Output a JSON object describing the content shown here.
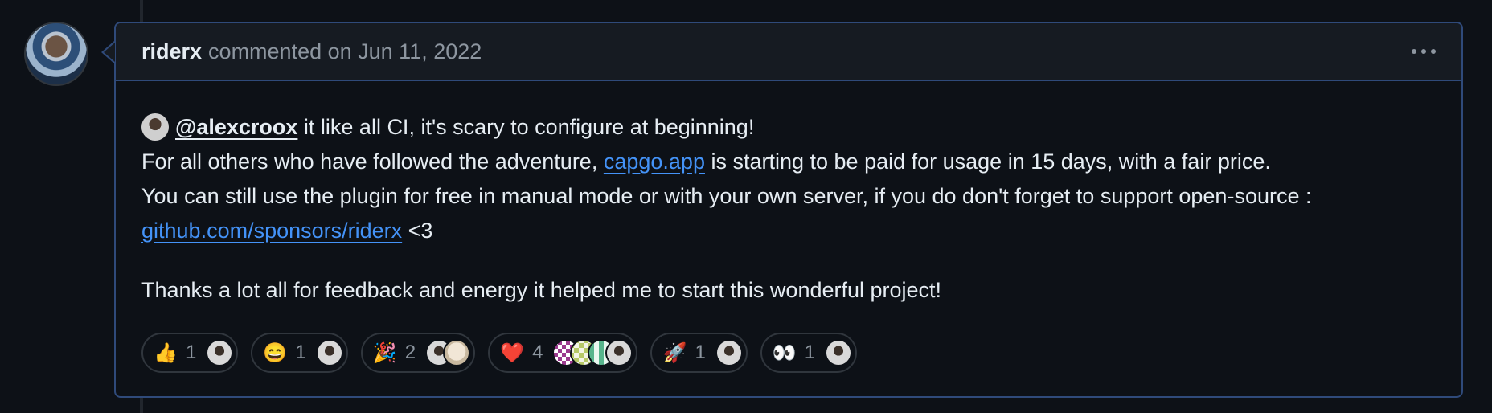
{
  "comment": {
    "author": "riderx",
    "meta": "commented on Jun 11, 2022",
    "line1": {
      "mention": "@alexcroox",
      "text": " it like all CI, it's scary to configure at beginning!"
    },
    "line2": {
      "before": "For all others who have followed the adventure, ",
      "link": "capgo.app",
      "after": " is starting to be paid for usage in 15 days, with a fair price."
    },
    "line3": "You can still use the plugin for free in manual mode or with your own server, if you do don't forget to support open-source :",
    "line4": {
      "link": "github.com/sponsors/riderx",
      "after": " <3"
    },
    "paragraph2": "Thanks a lot all for feedback and energy it helped me to start this wonderful project!"
  },
  "reactions": [
    {
      "emoji": "👍",
      "count": "1",
      "icon": "thumbs-up-icon"
    },
    {
      "emoji": "😄",
      "count": "1",
      "icon": "laugh-icon"
    },
    {
      "emoji": "🎉",
      "count": "2",
      "icon": "hooray-icon"
    },
    {
      "emoji": "❤️",
      "count": "4",
      "icon": "heart-icon"
    },
    {
      "emoji": "🚀",
      "count": "1",
      "icon": "rocket-icon"
    },
    {
      "emoji": "👀",
      "count": "1",
      "icon": "eyes-icon"
    }
  ],
  "colors": {
    "background": "#0d1117",
    "header_bg": "#161b22",
    "border_accent": "#2f4a7a",
    "link": "#4493f8",
    "muted": "#8d96a0"
  }
}
